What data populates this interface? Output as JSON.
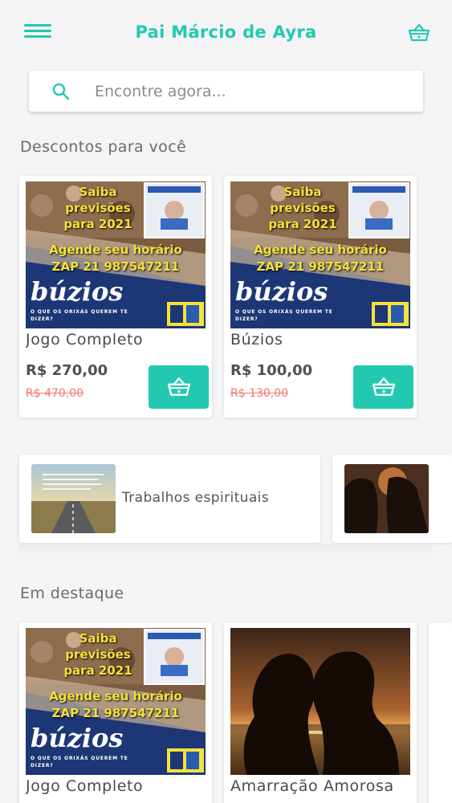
{
  "header": {
    "title": "Pai Márcio de Ayra"
  },
  "search": {
    "placeholder": "Encontre agora..."
  },
  "discounts": {
    "title": "Descontos para você",
    "products": [
      {
        "image": {
          "headline": "Saiba previsões para 2021",
          "line1": "Agende seu horário",
          "line2": "ZAP 21 987547211",
          "script": "búzios",
          "sub": "O QUE OS ORIXÁS QUEREM TE DIZER?"
        },
        "name": "Jogo Completo",
        "price": "R$ 270,00",
        "old_price": "R$ 470,00"
      },
      {
        "image": {
          "headline": "Saiba previsões para 2021",
          "line1": "Agende seu horário",
          "line2": "ZAP 21 987547211",
          "script": "búzios",
          "sub": "O QUE OS ORIXÁS QUEREM TE DIZER?"
        },
        "name": "Búzios",
        "price": "R$ 100,00",
        "old_price": "R$ 130,00"
      }
    ]
  },
  "categories": [
    {
      "label": "Trabalhos espirituais"
    }
  ],
  "featured": {
    "title": "Em destaque",
    "products": [
      {
        "image": {
          "headline": "Saiba previsões para 2021",
          "line1": "Agende seu horário",
          "line2": "ZAP 21 987547211",
          "script": "búzios",
          "sub": "O QUE OS ORIXÁS QUEREM TE DIZER?"
        },
        "name": "Jogo Completo"
      },
      {
        "name": "Amarração Amorosa"
      }
    ]
  },
  "colors": {
    "accent": "#22c9b0",
    "old_price": "#f07b6a",
    "banner_blue": "#1d3675",
    "banner_yellow": "#f5e23a"
  },
  "icons": [
    "menu-icon",
    "basket-icon",
    "search-icon",
    "add-to-cart-icon"
  ]
}
